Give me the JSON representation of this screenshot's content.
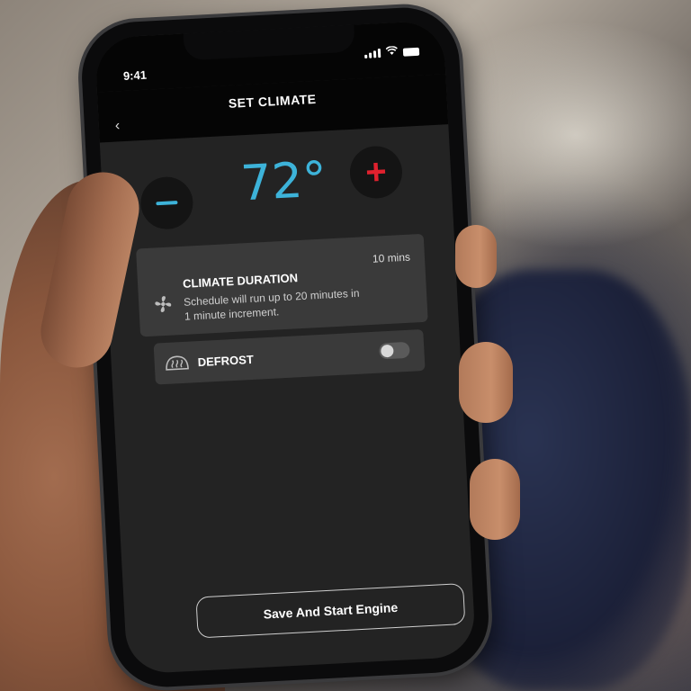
{
  "status_bar": {
    "time": "9:41",
    "icons": [
      "signal-icon",
      "wifi-icon",
      "battery-icon"
    ]
  },
  "header": {
    "title": "SET CLIMATE",
    "back_icon": "‹"
  },
  "temperature": {
    "value": "72°",
    "decrease_icon": "minus-icon",
    "increase_symbol": "+",
    "accent_color": "#3db3d9",
    "increase_color": "#e0212e"
  },
  "climate_duration": {
    "title": "CLIMATE DURATION",
    "value": "10 mins",
    "description": "Schedule will run up to 20 minutes in 1 minute increment.",
    "icon": "fan-icon"
  },
  "defrost": {
    "label": "DEFROST",
    "icon": "defrost-icon",
    "enabled": false
  },
  "actions": {
    "save_label": "Save And Start Engine"
  }
}
